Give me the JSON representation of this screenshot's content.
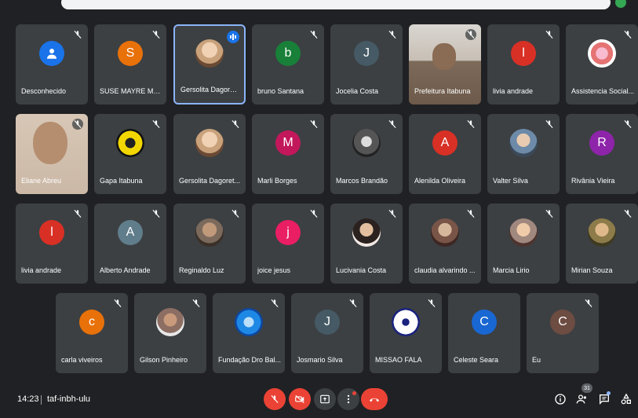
{
  "meeting": {
    "time": "14:23",
    "code": "taf-inbh-ulu",
    "participant_count": "31"
  },
  "colors": {
    "background": "#202124",
    "tile": "#3c4043",
    "end_call": "#ea4335",
    "active_speaker_border": "#8ab4f8"
  },
  "tiles": [
    {
      "name": "Desconhecido",
      "avatar": "person-icon",
      "color": "#1a73e8"
    },
    {
      "name": "SUSE MAYRE MO...",
      "initial": "S",
      "color": "#e8710a"
    },
    {
      "name": "Gersolita Dagoret...",
      "avatar": "profile-photo",
      "color": "#c9a27c",
      "speaking": true
    },
    {
      "name": "bruno Santana",
      "initial": "b",
      "color": "#188038"
    },
    {
      "name": "Jocelia Costa",
      "initial": "J",
      "color": "#455a64"
    },
    {
      "name": "Prefeitura Itabuna",
      "avatar": "camera-feed",
      "color": "#8a7b6e"
    },
    {
      "name": "livia andrade",
      "initial": "l",
      "color": "#d93025"
    },
    {
      "name": "Assistencia Social...",
      "avatar": "logo",
      "color": "#e57373"
    },
    {
      "name": "Eliane Abreu",
      "avatar": "camera-feed",
      "color": "#9e8f84"
    },
    {
      "name": "Gapa Itabuna",
      "avatar": "logo",
      "color": "#f2d600"
    },
    {
      "name": "Gersolita Dagoret...",
      "avatar": "profile-photo",
      "color": "#c9a27c"
    },
    {
      "name": "Marli Borges",
      "initial": "M",
      "color": "#c2185b"
    },
    {
      "name": "Marcos Brandão",
      "avatar": "profile-photo",
      "color": "#777777"
    },
    {
      "name": "Alenilda Oliveira",
      "initial": "A",
      "color": "#d93025"
    },
    {
      "name": "Valter Silva",
      "avatar": "profile-photo",
      "color": "#6d8aa8"
    },
    {
      "name": "Rivânia Vieira",
      "initial": "R",
      "color": "#8e24aa"
    },
    {
      "name": "livia andrade",
      "initial": "l",
      "color": "#d93025"
    },
    {
      "name": "Alberto Andrade",
      "initial": "A",
      "color": "#607d8b"
    },
    {
      "name": "Reginaldo Luz",
      "avatar": "profile-photo",
      "color": "#7b6a5c"
    },
    {
      "name": "joice jesus",
      "initial": "j",
      "color": "#e91e63"
    },
    {
      "name": "Lucivania Costa",
      "avatar": "profile-photo",
      "color": "#8d6e63"
    },
    {
      "name": "claudia alvarindo ...",
      "avatar": "profile-photo",
      "color": "#795548"
    },
    {
      "name": "Marcia Lirio",
      "avatar": "profile-photo",
      "color": "#a1887f"
    },
    {
      "name": "Mirian Souza",
      "avatar": "profile-photo",
      "color": "#8d7b4a"
    },
    {
      "name": "carla viveiros",
      "initial": "c",
      "color": "#e8710a"
    },
    {
      "name": "Gilson Pinheiro",
      "avatar": "profile-photo",
      "color": "#8d6e63"
    },
    {
      "name": "Fundação Dro Bal...",
      "avatar": "logo",
      "color": "#1e88e5"
    },
    {
      "name": "Josmario Silva",
      "initial": "J",
      "color": "#455a64"
    },
    {
      "name": "MISSAO FALA",
      "avatar": "logo",
      "color": "#ffffff"
    },
    {
      "name": "Celeste Seara",
      "initial": "C",
      "color": "#1967d2"
    },
    {
      "name": "Eu",
      "initial": "C",
      "color": "#6d4c41"
    }
  ]
}
